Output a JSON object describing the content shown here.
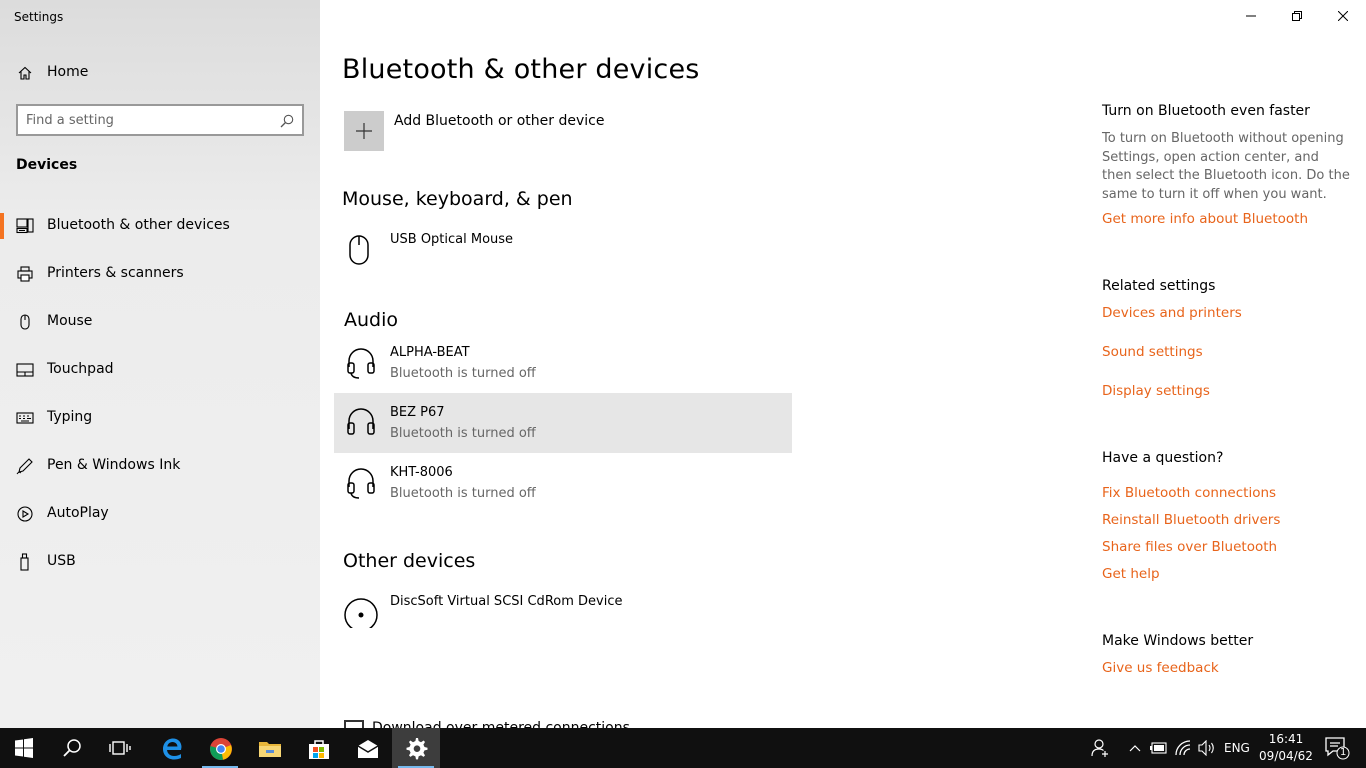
{
  "window": {
    "title": "Settings",
    "minimize_icon": "minimize-icon",
    "restore_icon": "restore-icon",
    "close_icon": "close-icon"
  },
  "sidebar": {
    "home_label": "Home",
    "search_placeholder": "Find a setting",
    "section_label": "Devices",
    "items": [
      {
        "label": "Bluetooth & other devices",
        "icon": "bluetooth-devices-icon",
        "active": true
      },
      {
        "label": "Printers & scanners",
        "icon": "printer-icon",
        "active": false
      },
      {
        "label": "Mouse",
        "icon": "mouse-icon",
        "active": false
      },
      {
        "label": "Touchpad",
        "icon": "touchpad-icon",
        "active": false
      },
      {
        "label": "Typing",
        "icon": "keyboard-icon",
        "active": false
      },
      {
        "label": "Pen & Windows Ink",
        "icon": "pen-icon",
        "active": false
      },
      {
        "label": "AutoPlay",
        "icon": "autoplay-icon",
        "active": false
      },
      {
        "label": "USB",
        "icon": "usb-icon",
        "active": false
      }
    ],
    "accent_color": "#f47321"
  },
  "main": {
    "title": "Bluetooth & other devices",
    "add_device_label": "Add Bluetooth or other device",
    "groups": [
      {
        "title": "Mouse, keyboard, & pen",
        "devices": [
          {
            "name": "USB Optical Mouse",
            "status": "",
            "icon": "mouse-icon"
          }
        ]
      },
      {
        "title": "Audio",
        "devices": [
          {
            "name": "ALPHA-BEAT",
            "status": "Bluetooth is turned off",
            "icon": "headset-icon"
          },
          {
            "name": "BEZ P67",
            "status": "Bluetooth is turned off",
            "icon": "headphones-icon",
            "selected": true
          },
          {
            "name": "KHT-8006",
            "status": "Bluetooth is turned off",
            "icon": "headset-icon"
          }
        ]
      },
      {
        "title": "Other devices",
        "devices": [
          {
            "name": "DiscSoft Virtual SCSI CdRom Device",
            "status": "",
            "icon": "disc-icon"
          }
        ]
      }
    ],
    "partial_checkbox_label": "Download over metered connections"
  },
  "right_panel": {
    "tip_heading": "Turn on Bluetooth even faster",
    "tip_text": "To turn on Bluetooth without opening Settings, open action center, and then select the Bluetooth icon. Do the same to turn it off when you want.",
    "tip_link": "Get more info about Bluetooth",
    "related_heading": "Related settings",
    "related_links": [
      "Devices and printers",
      "Sound settings",
      "Display settings"
    ],
    "question_heading": "Have a question?",
    "question_links": [
      "Fix Bluetooth connections",
      "Reinstall Bluetooth drivers",
      "Share files over Bluetooth",
      "Get help"
    ],
    "feedback_heading": "Make Windows better",
    "feedback_link": "Give us feedback",
    "link_color": "#e8641b"
  },
  "taskbar": {
    "apps": [
      "start-icon",
      "search-icon",
      "task-view-icon",
      "edge-icon",
      "chrome-icon",
      "file-explorer-icon",
      "store-icon",
      "mail-icon",
      "settings-icon"
    ],
    "language": "ENG",
    "time": "16:41",
    "date": "09/04/62",
    "notification_count": "1"
  }
}
